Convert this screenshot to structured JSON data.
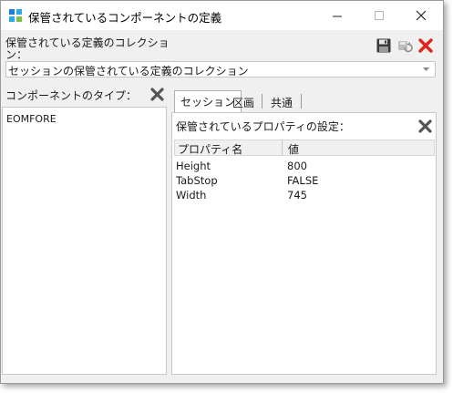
{
  "window": {
    "title": "保管されているコンポーネントの定義"
  },
  "collection": {
    "label": "保管されている定義のコレクション\n：",
    "label_line1": "保管されている定義のコレクショ",
    "label_line2": "ン：",
    "selected": "セッションの保管されている定義のコレクション"
  },
  "toolbar": {
    "save_icon": "save-icon",
    "delete_icon": "red-x-icon"
  },
  "component_types": {
    "label": "コンポーネントのタイプ：",
    "items": [
      "EOMFORE"
    ]
  },
  "tabs": [
    {
      "label": "セッション",
      "active": true
    },
    {
      "label": "区画",
      "active": false
    },
    {
      "label": "共通",
      "active": false
    }
  ],
  "properties": {
    "label": "保管されているプロパティの設定：",
    "columns": [
      "プロパティ名",
      "値"
    ],
    "rows": [
      {
        "name": "Height",
        "value": "800"
      },
      {
        "name": "TabStop",
        "value": "FALSE"
      },
      {
        "name": "Width",
        "value": "745"
      }
    ]
  },
  "colors": {
    "delete_red": "#e2231a",
    "gray_x": "#555555"
  }
}
